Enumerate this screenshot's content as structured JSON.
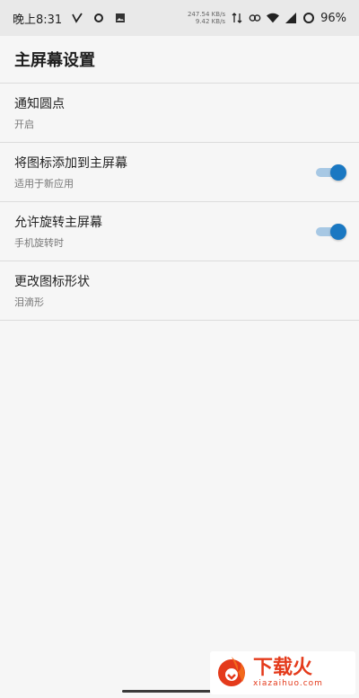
{
  "status_bar": {
    "time": "晚上8:31",
    "icons": [
      "v-check-icon",
      "circle-icon",
      "image-icon"
    ],
    "net_speed_up": "247.54 KB/s",
    "net_speed_down": "9.42 KB/s",
    "battery": "96%"
  },
  "header": {
    "title": "主屏幕设置"
  },
  "settings": [
    {
      "title": "通知圆点",
      "subtitle": "开启",
      "toggle": null
    },
    {
      "title": "将图标添加到主屏幕",
      "subtitle": "适用于新应用",
      "toggle": true
    },
    {
      "title": "允许旋转主屏幕",
      "subtitle": "手机旋转时",
      "toggle": true
    },
    {
      "title": "更改图标形状",
      "subtitle": "泪滴形",
      "toggle": null
    }
  ],
  "watermark": {
    "title": "下载火",
    "url": "xiazaihuo.com"
  },
  "colors": {
    "accent": "#1a78c2",
    "toggle_track": "#a7c8e4",
    "watermark": "#e43a1b"
  }
}
